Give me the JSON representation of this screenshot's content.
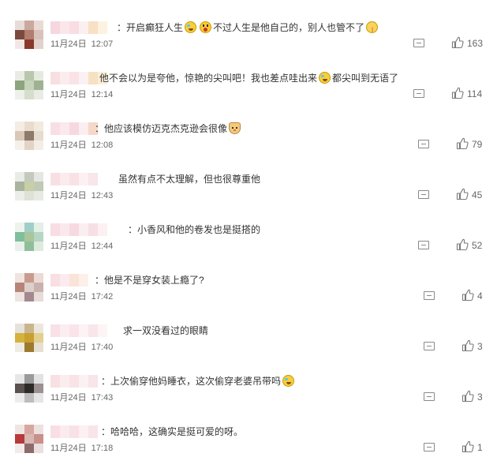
{
  "comments": [
    {
      "text_parts": [
        "：开启癫狂人生",
        "不过人生是他自己的，别人也管不了"
      ],
      "emojis": [
        "laugh-cry-icon",
        "shocked-face-icon",
        "shushing-face-icon"
      ],
      "date": "11月24日",
      "time": "12:07",
      "likes": "163",
      "avatar_colors": [
        "#e8dcd8",
        "#c9a99e",
        "#ead9d4",
        "#7b4a3c",
        "#b07d6e",
        "#d8c2ba",
        "#f1e8e6",
        "#8a3a2a",
        "#e3d2cc"
      ],
      "name_colors": [
        "#f6d7df",
        "#fbe6ea",
        "#f9dde3",
        "#fbeff1",
        "#f7e0c4",
        "#fdf2e1"
      ]
    },
    {
      "text_parts": [
        "他不会以为是夸他，惊艳的尖叫吧！我也差点哇出来",
        "都尖叫到无语了"
      ],
      "emojis": [
        "laugh-cry-icon"
      ],
      "date": "11月24日",
      "time": "12:14",
      "likes": "114",
      "avatar_colors": [
        "#eaece4",
        "#b9c7ad",
        "#e5eadf",
        "#8da47c",
        "#c6d3bb",
        "#9fb192",
        "#eef0ea",
        "#d5ddcd",
        "#e9ece5"
      ],
      "name_colors": [
        "#f7dfe2",
        "#fbecee",
        "#fae3e6",
        "#fcf1f2",
        "#f6e2c2",
        "#fcefd9"
      ]
    },
    {
      "text_parts": [
        "：他应该模仿迈克杰克逊会很像"
      ],
      "emojis": [
        "cat-face-icon"
      ],
      "date": "11月24日",
      "time": "12:08",
      "likes": "79",
      "avatar_colors": [
        "#f5ede4",
        "#e9dccd",
        "#f3eadf",
        "#d9c8b5",
        "#8e7a6c",
        "#e7dcd0",
        "#f6f0ea",
        "#e2d3c4",
        "#f4ede6"
      ],
      "name_colors": [
        "#f8dfe5",
        "#fbe9ed",
        "#f6d9e0",
        "#fbeef1",
        "#f5d8c8",
        "#fae8de"
      ]
    },
    {
      "text_parts": [
        "虽然有点不太理解，但也很尊重他"
      ],
      "emojis": [],
      "date": "11月24日",
      "time": "12:43",
      "likes": "45",
      "avatar_colors": [
        "#e9ebe6",
        "#c3c9bd",
        "#e4e7e1",
        "#a9b39e",
        "#c7cfa6",
        "#bfc9b5",
        "#eceee9",
        "#dde1d8",
        "#e7eae3"
      ],
      "name_colors": [
        "#f8dfe3",
        "#fbebee",
        "#f9e2e6",
        "#fcf0f2",
        "#f8e6e9",
        "#fdf3f5"
      ]
    },
    {
      "text_parts": [
        "：小香风和他的卷发也是挺搭的"
      ],
      "emojis": [],
      "date": "11月24日",
      "time": "12:44",
      "likes": "52",
      "avatar_colors": [
        "#eef3ee",
        "#9fcfc8",
        "#e4efe6",
        "#7fbf9c",
        "#a9c69a",
        "#b4d6c2",
        "#e9f1eb",
        "#8fbf9a",
        "#dfeadf"
      ],
      "name_colors": [
        "#f8dde4",
        "#fbe8ed",
        "#f7d9e1",
        "#fbeef2",
        "#f7dfe6",
        "#fcf0f3"
      ]
    },
    {
      "text_parts": [
        "：他是不是穿女装上瘾了?"
      ],
      "emojis": [],
      "date": "11月24日",
      "time": "17:42",
      "likes": "4",
      "avatar_colors": [
        "#f0e4e0",
        "#c99b8e",
        "#eadbd6",
        "#b78578",
        "#ddd0cc",
        "#c9b2ad",
        "#eee4e2",
        "#a48890",
        "#e7dcd8"
      ],
      "name_colors": [
        "#f9dfe4",
        "#fbebee",
        "#f9e4d8",
        "#fcf0e8",
        "#f6dcc4",
        "#fbeee0"
      ]
    },
    {
      "text_parts": [
        "求一双没看过的眼睛"
      ],
      "emojis": [],
      "date": "11月24日",
      "time": "17:40",
      "likes": "3",
      "avatar_colors": [
        "#e5e2dc",
        "#c9b68f",
        "#ebe7dd",
        "#d4b23c",
        "#c9a030",
        "#e3cf8f",
        "#efece4",
        "#9c7a2c",
        "#e6e0d2"
      ],
      "name_colors": [
        "#f9e1e6",
        "#fcedf0",
        "#fae4e9",
        "#fdf2f4",
        "#f9e6ea",
        "#fdf4f6"
      ]
    },
    {
      "text_parts": [
        "：上次偷穿他妈睡衣，这次偷穿老婆吊带吗"
      ],
      "emojis": [
        "laugh-cry-icon"
      ],
      "date": "11月24日",
      "time": "17:43",
      "likes": "3",
      "avatar_colors": [
        "#e7e7e7",
        "#9a9a9a",
        "#e2e2e2",
        "#5a5250",
        "#2e2a28",
        "#9a9190",
        "#ececec",
        "#bdbdbd",
        "#e5e5e5"
      ],
      "name_colors": [
        "#f8e0e3",
        "#fbecee",
        "#f9e3e6",
        "#fcf1f2",
        "#f8e5e8",
        "#fdf3f4"
      ]
    },
    {
      "text_parts": [
        "：哈哈哈，这确实是挺可爱的呀。"
      ],
      "emojis": [],
      "date": "11月24日",
      "time": "17:18",
      "likes": "1",
      "avatar_colors": [
        "#efe6e4",
        "#d7a7a0",
        "#ece1df",
        "#b73a3a",
        "#d9b7b3",
        "#c98f8a",
        "#f2ebea",
        "#8c6c6a",
        "#e9dfde"
      ],
      "name_colors": [
        "#f9dfe4",
        "#fbebee",
        "#f9e2e7",
        "#fcf0f3",
        "#f8e5ea",
        "#fdf3f6"
      ]
    }
  ]
}
